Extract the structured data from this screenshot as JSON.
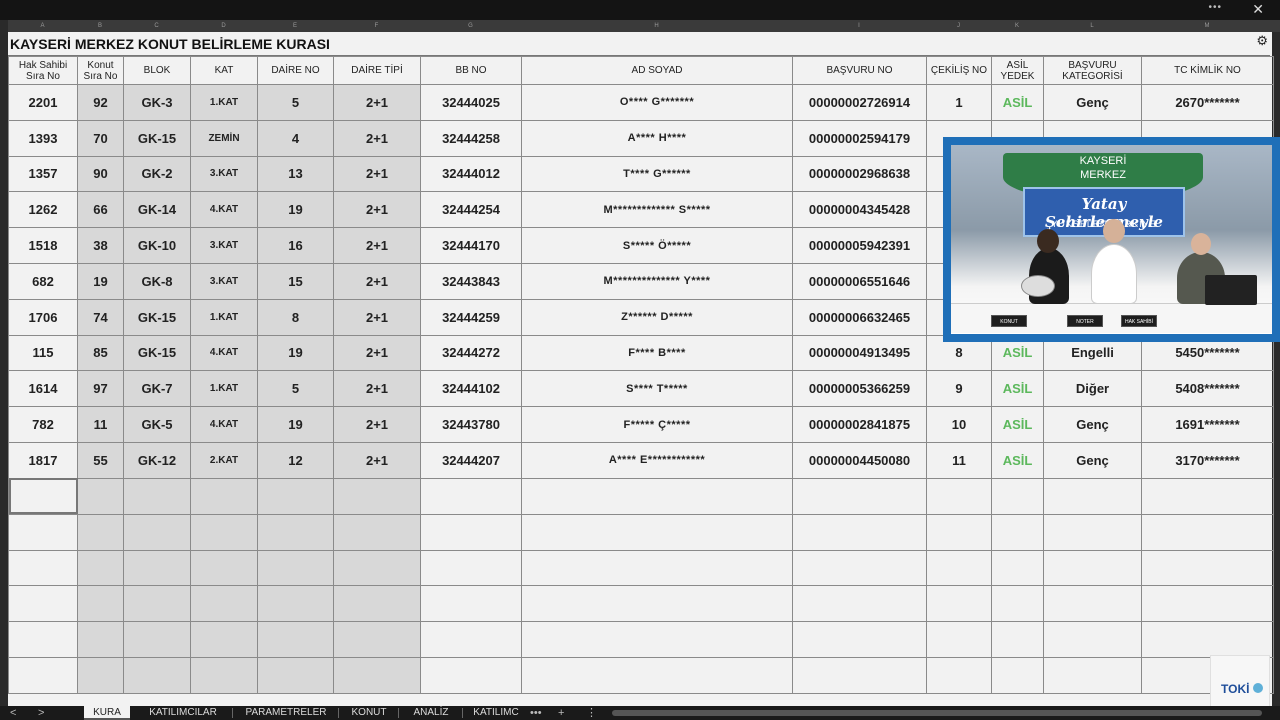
{
  "window": {
    "menu_dots": "•••",
    "close": "✕"
  },
  "col_letters": [
    "A",
    "B",
    "C",
    "D",
    "E",
    "F",
    "G",
    "H",
    "I",
    "J",
    "K",
    "L",
    "M"
  ],
  "title": "KAYSERİ MERKEZ KONUT BELİRLEME KURASI",
  "headers": [
    "Hak Sahibi Sıra No",
    "Konut Sıra No",
    "BLOK",
    "KAT",
    "DAİRE NO",
    "DAİRE TİPİ",
    "BB NO",
    "AD SOYAD",
    "BAŞVURU NO",
    "ÇEKİLİŞ NO",
    "ASİL YEDEK",
    "BAŞVURU KATEGORİSİ",
    "TC KİMLİK NO"
  ],
  "rows": [
    [
      "2201",
      "92",
      "GK-3",
      "1.KAT",
      "5",
      "2+1",
      "32444025",
      "O**** G*******",
      "00000002726914",
      "1",
      "ASİL",
      "Genç",
      "2670*******"
    ],
    [
      "1393",
      "70",
      "GK-15",
      "ZEMİN",
      "4",
      "2+1",
      "32444258",
      "A**** H****",
      "00000002594179",
      "",
      "",
      "",
      ""
    ],
    [
      "1357",
      "90",
      "GK-2",
      "3.KAT",
      "13",
      "2+1",
      "32444012",
      "T**** G******",
      "00000002968638",
      "",
      "",
      "",
      ""
    ],
    [
      "1262",
      "66",
      "GK-14",
      "4.KAT",
      "19",
      "2+1",
      "32444254",
      "M************* S*****",
      "00000004345428",
      "",
      "",
      "",
      ""
    ],
    [
      "1518",
      "38",
      "GK-10",
      "3.KAT",
      "16",
      "2+1",
      "32444170",
      "S***** Ö*****",
      "00000005942391",
      "",
      "",
      "",
      ""
    ],
    [
      "682",
      "19",
      "GK-8",
      "3.KAT",
      "15",
      "2+1",
      "32443843",
      "M************** Y****",
      "00000006551646",
      "",
      "",
      "",
      ""
    ],
    [
      "1706",
      "74",
      "GK-15",
      "1.KAT",
      "8",
      "2+1",
      "32444259",
      "Z****** D*****",
      "00000006632465",
      "",
      "",
      "",
      ""
    ],
    [
      "115",
      "85",
      "GK-15",
      "4.KAT",
      "19",
      "2+1",
      "32444272",
      "F**** B****",
      "00000004913495",
      "8",
      "ASİL",
      "Engelli",
      "5450*******"
    ],
    [
      "1614",
      "97",
      "GK-7",
      "1.KAT",
      "5",
      "2+1",
      "32444102",
      "S**** T*****",
      "00000005366259",
      "9",
      "ASİL",
      "Diğer",
      "5408*******"
    ],
    [
      "782",
      "11",
      "GK-5",
      "4.KAT",
      "19",
      "2+1",
      "32443780",
      "F***** Ç*****",
      "00000002841875",
      "10",
      "ASİL",
      "Genç",
      "1691*******"
    ],
    [
      "1817",
      "55",
      "GK-12",
      "2.KAT",
      "12",
      "2+1",
      "32444207",
      "A**** E************",
      "00000004450080",
      "11",
      "ASİL",
      "Genç",
      "3170*******"
    ]
  ],
  "empty_rows": 6,
  "video": {
    "banner_line1": "KAYSERİ",
    "banner_line2": "MERKEZ",
    "slogan_line1": "Yatay Şehirleşmeyle",
    "slogan_line2": "YÜKSELEN TÜRKİYE",
    "plate1": "KONUT",
    "plate2": "NOTER",
    "plate3": "HAK SAHİBİ"
  },
  "logo": "TOKİ",
  "tabs": [
    "KURA",
    "KATILIMCILAR",
    "PARAMETRELER",
    "KONUT",
    "ANALİZ",
    "KATILIMC"
  ],
  "tab_controls": {
    "prev": "<",
    "next": ">",
    "more": "•••",
    "add": "+",
    "menu": "⋮"
  },
  "accent_asil": "#5cb85c",
  "pip_border": "#1f6fb8"
}
